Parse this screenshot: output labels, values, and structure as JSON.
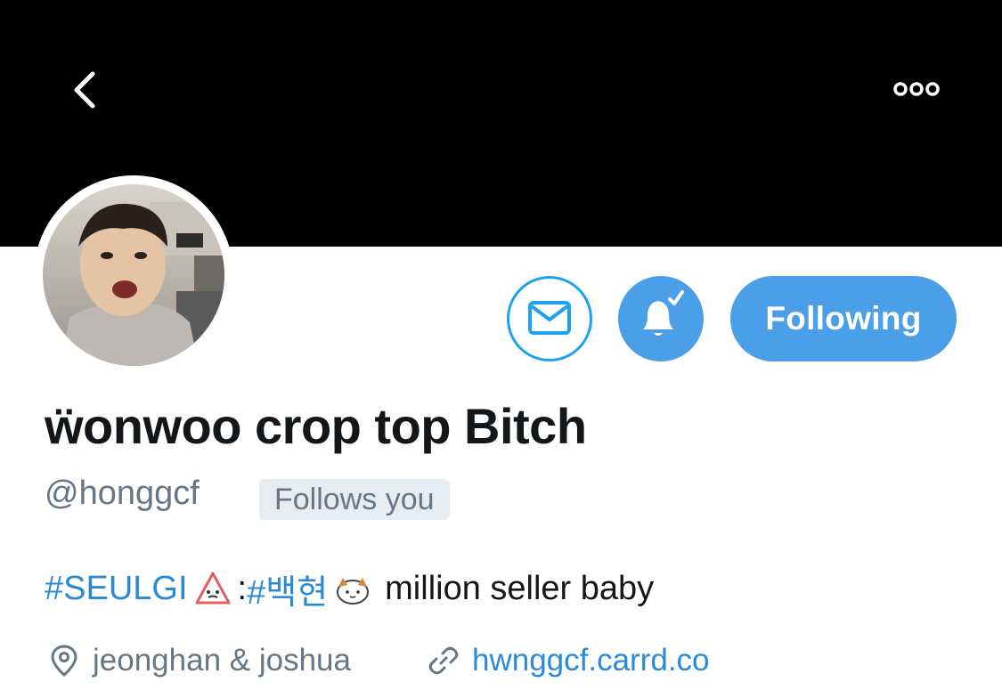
{
  "header": {
    "back_icon": "chevron-left-icon",
    "more_icon": "ellipsis-icon",
    "banner_color": "#000000"
  },
  "profile": {
    "display_name": "ẅonwoo crop top Bitch",
    "handle": "@honggcf",
    "follows_you_badge": "Follows you"
  },
  "actions": {
    "message_icon": "envelope-icon",
    "notifications_icon": "bell-check-icon",
    "following_label": "Following",
    "accent_color": "#4a9fe8"
  },
  "bio": {
    "hashtag1": "#SEULGI",
    "separator": " : ",
    "hashtag2": "#백현",
    "text": "million seller baby"
  },
  "meta": {
    "location": "jeonghan & joshua",
    "website": "hwnggcf.carrd.co"
  }
}
